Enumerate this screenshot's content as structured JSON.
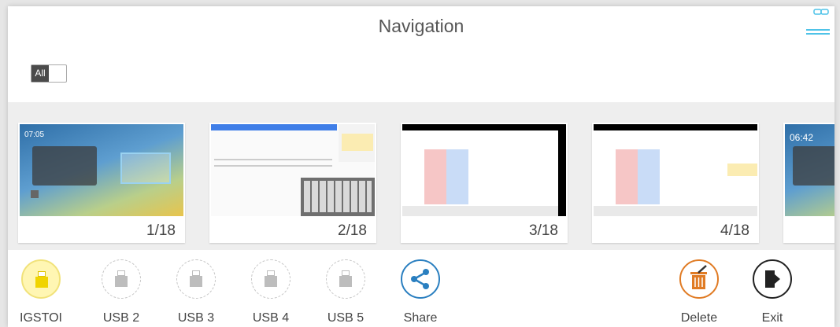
{
  "header": {
    "title": "Navigation"
  },
  "filter": {
    "toggle_label": "All"
  },
  "thumbnails": [
    {
      "page": "1/18"
    },
    {
      "page": "2/18"
    },
    {
      "page": "3/18"
    },
    {
      "page": "4/18"
    }
  ],
  "thumb1": {
    "clock": "07:05"
  },
  "thumb5": {
    "clock": "06:42"
  },
  "toolbar": {
    "usb1_label": "IGSTOI",
    "usb2_label": "USB 2",
    "usb3_label": "USB 3",
    "usb4_label": "USB 4",
    "usb5_label": "USB 5",
    "share_label": "Share",
    "delete_label": "Delete",
    "exit_label": "Exit"
  },
  "colors": {
    "usb_active": "#f5e04a",
    "share": "#2a7fc0",
    "delete": "#e07b24",
    "exit": "#222222"
  },
  "icons": [
    "menu-icon",
    "usb-drive-icon",
    "share-icon",
    "trash-icon",
    "exit-door-icon"
  ]
}
